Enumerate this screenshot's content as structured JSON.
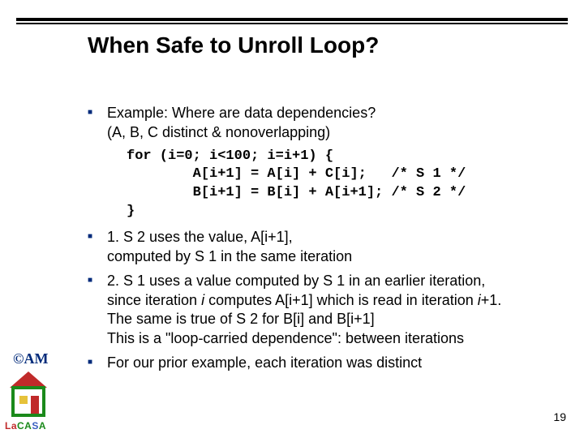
{
  "title": "When Safe to Unroll Loop?",
  "bullets": {
    "b1a": "Example: Where are data dependencies?",
    "b1b": "(A, B, C distinct & nonoverlapping)",
    "b2a": "1. S 2 uses the value, A[i+1],",
    "b2b": "computed by S 1 in the same iteration",
    "b3a": "2. S 1 uses a value computed by S 1 in an earlier iteration,",
    "b3b_pre": "since iteration ",
    "b3b_i": "i",
    "b3b_mid": " computes A[i+1] which is read in iteration ",
    "b3b_i2": "i",
    "b3b_post": "+1.",
    "b3c": "The same is true of S 2 for B[i] and B[i+1]",
    "b3d": "This is a \"loop-carried dependence\": between iterations",
    "b4": "For our prior example, each iteration was distinct"
  },
  "code": "for (i=0; i<100; i=i+1) {\n        A[i+1] = A[i] + C[i];   /* S 1 */\n        B[i+1] = B[i] + A[i+1]; /* S 2 */\n}",
  "logo": {
    "am": "©AM",
    "la": "La",
    "ca": "CA",
    "s": "S",
    "a2": "A"
  },
  "slide_number": "19"
}
